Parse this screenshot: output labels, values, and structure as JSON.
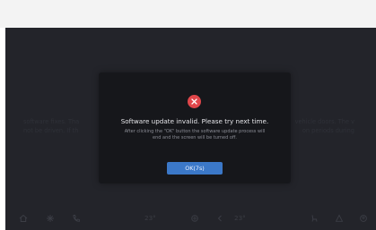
{
  "dialog": {
    "title": "Software update invalid. Please try next time.",
    "description_line1": "After clicking the \"OK\" button the software update process will",
    "description_line2": "end and the screen will be turned off.",
    "ok_label": "OK(7s)",
    "icon": "close-icon",
    "colors": {
      "error": "#e0464a",
      "button": "#3b78c8"
    }
  },
  "background": {
    "left_line1": "software fixes. Tha",
    "left_line2": "not be driven. If th",
    "right_line1": "vehicle doors. The v",
    "right_line2": "on periods during"
  },
  "dock": {
    "temp_left": "23°",
    "temp_right": "23°",
    "icons": [
      "home-icon",
      "fan-icon",
      "phone-icon",
      "ac-icon",
      "seat-icon",
      "settings-icon",
      "profile-icon"
    ]
  }
}
